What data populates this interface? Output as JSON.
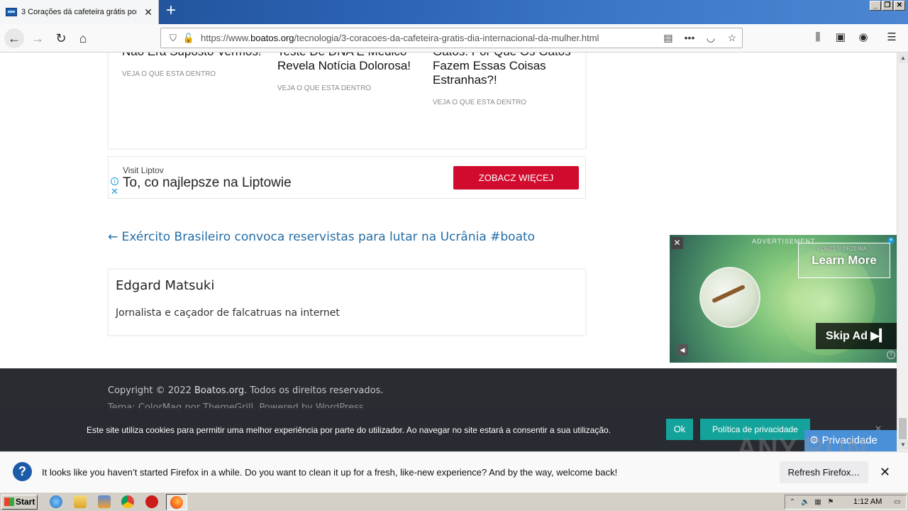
{
  "browser": {
    "tab_title": "3 Corações dá cafeteira grátis por",
    "url_prefix": "https://www.",
    "url_domain": "boatos.org",
    "url_path": "/tecnologia/3-coracoes-da-cafeteira-gratis-dia-internacional-da-mulher.html"
  },
  "recommendations": [
    {
      "title": "Não Era Suposto Vermos!",
      "sub": "VEJA O QUE ESTA DENTRO"
    },
    {
      "title": "Teste De DNA E Médico Revela Notícia Dolorosa!",
      "sub": "VEJA O QUE ESTA DENTRO"
    },
    {
      "title": "Gatos: Por Que Os Gatos Fazem Essas Coisas Estranhas?!",
      "sub": "VEJA O QUE ESTA DENTRO"
    }
  ],
  "ad_banner": {
    "advertiser": "Visit Liptov",
    "text": "To, co najlepsze na Liptowie",
    "cta": "ZOBACZ WIĘCEJ"
  },
  "prev_post": "← Exército Brasileiro convoca reservistas para lutar na Ucrânia #boato",
  "author": {
    "name": "Edgard Matsuki",
    "bio": "Jornalista e caçador de falcatruas na internet"
  },
  "video_ad": {
    "label": "ADVERTISEMENT",
    "brand": "KORZEŃ DRZEWA",
    "learn_more": "Learn More",
    "skip": "Skip Ad ▶▎"
  },
  "footer": {
    "copyright_prefix": "Copyright © 2022 ",
    "copyright_link": "Boatos.org",
    "copyright_suffix": ". Todos os direitos reservados.",
    "powered": "Tema: ColorMag por ThemeGrill. Powered by WordPress."
  },
  "cookie": {
    "message": "Este site utiliza cookies para permitir uma melhor experiência por parte do utilizador. Ao navegar no site estará a consentir a sua utilização.",
    "ok": "Ok",
    "policy": "Política de privacidade",
    "privacy_button": "⚙ Privacidade"
  },
  "notification": {
    "text": "It looks like you haven’t started Firefox in a while. Do you want to clean it up for a fresh, like-new experience? And by the way, welcome back!",
    "refresh": "Refresh Firefox…"
  },
  "watermark": "ANY.RUN",
  "taskbar": {
    "start": "Start",
    "time": "1:12 AM"
  }
}
